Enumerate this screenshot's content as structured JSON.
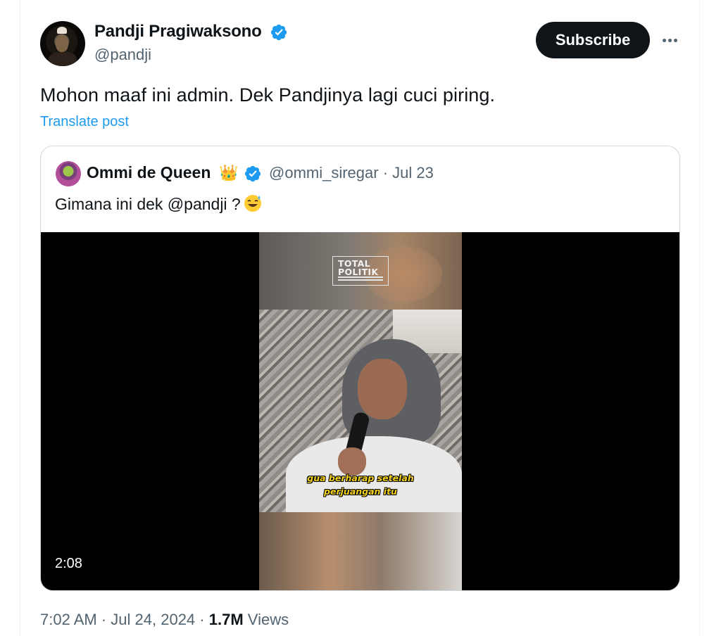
{
  "post": {
    "author": {
      "display_name": "Pandji Pragiwaksono",
      "handle": "@pandji",
      "verified": true
    },
    "subscribe_label": "Subscribe",
    "more_icon": "more-horizontal-icon",
    "text": "Mohon maaf ini admin. Dek Pandjinya lagi cuci piring.",
    "translate_label": "Translate post",
    "time": "7:02 AM",
    "date": "Jul 24, 2024",
    "views_count": "1.7M",
    "views_label": "Views",
    "separator": "·"
  },
  "quoted": {
    "author": {
      "display_name": "Ommi de Queen",
      "crown_emoji": "👑",
      "handle": "@ommi_siregar",
      "date": "Jul 23",
      "verified": true
    },
    "meta": "@ommi_siregar · Jul 23",
    "text": "Gimana ini dek @pandji ?",
    "text_emoji": "sweat-smile-emoji",
    "video": {
      "duration": "2:08",
      "watermark_line1": "TOTAL",
      "watermark_line2": "POLITIK",
      "subtitle_line1": "gua berharap setelah",
      "subtitle_line2": "perjuangan itu"
    }
  },
  "colors": {
    "link_blue": "#1d9bf0",
    "verified_blue": "#1d9bf0",
    "text_primary": "#0f1419",
    "text_secondary": "#536471",
    "border": "#cfd9de",
    "caption_yellow": "#f4d21f"
  }
}
